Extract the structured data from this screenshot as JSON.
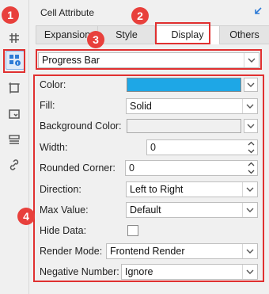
{
  "panel": {
    "title": "Cell Attribute"
  },
  "tabs": [
    {
      "label": "Expansion"
    },
    {
      "label": "Style"
    },
    {
      "label": "Display"
    },
    {
      "label": "Others"
    }
  ],
  "display_type": {
    "value": "Progress Bar"
  },
  "properties": {
    "color": {
      "label": "Color:",
      "value": "#1ea7e6"
    },
    "fill": {
      "label": "Fill:",
      "value": "Solid"
    },
    "background_color": {
      "label": "Background Color:"
    },
    "width": {
      "label": "Width:",
      "value": "0"
    },
    "rounded_corner": {
      "label": "Rounded Corner:",
      "value": "0"
    },
    "direction": {
      "label": "Direction:",
      "value": "Left to Right"
    },
    "max_value": {
      "label": "Max Value:",
      "value": "Default"
    },
    "hide_data": {
      "label": "Hide Data:",
      "checked": false
    },
    "render_mode": {
      "label": "Render Mode:",
      "value": "Frontend Render"
    },
    "negative_number": {
      "label": "Negative Number:",
      "value": "Ignore"
    }
  },
  "annotations": [
    "1",
    "2",
    "3",
    "4"
  ]
}
